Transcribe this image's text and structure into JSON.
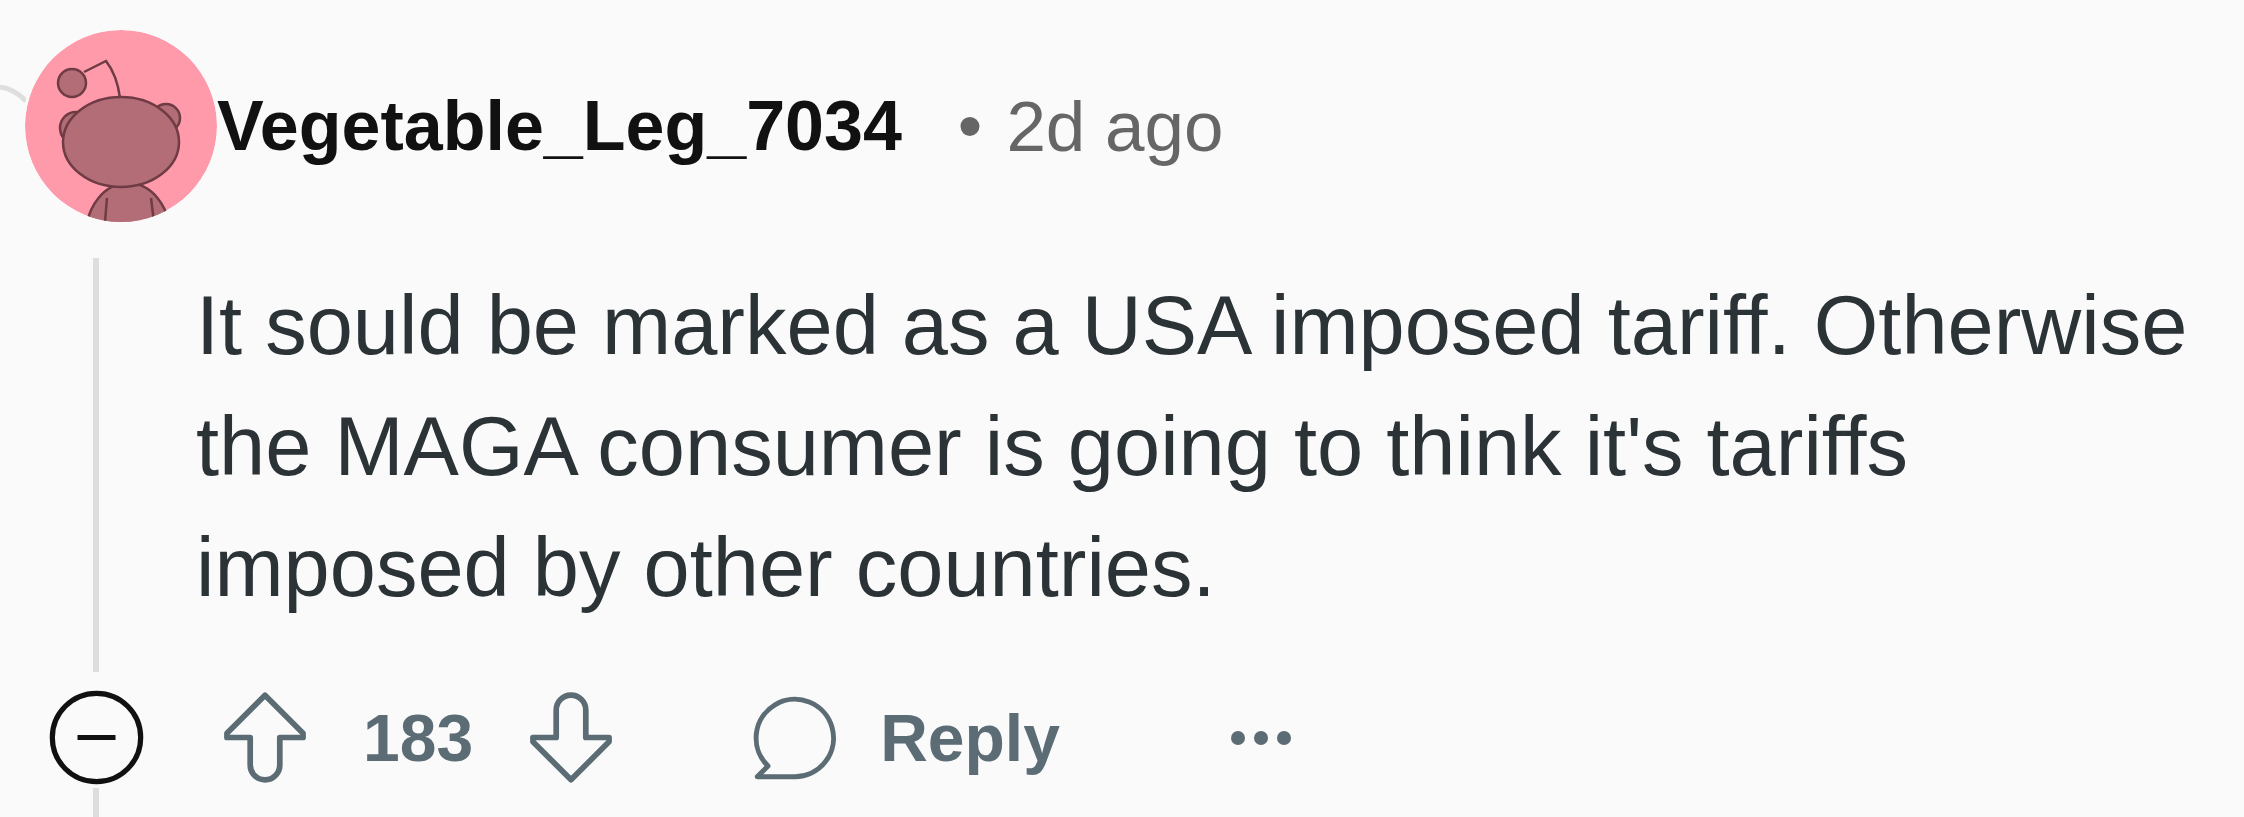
{
  "comment": {
    "author": "Vegetable_Leg_7034",
    "separator": "•",
    "age": "2d ago",
    "body": "It sould be marked as a USA imposed tariff. Otherwise the MAGA consumer is going to think it's tariffs imposed by other countries.",
    "score": "183",
    "reply_label": "Reply"
  }
}
